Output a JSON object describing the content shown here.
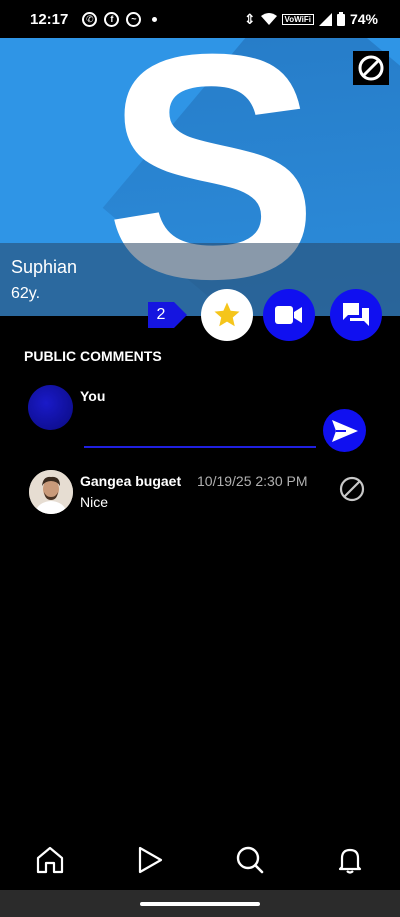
{
  "status_bar": {
    "time": "12:17",
    "app_icons": [
      "whatsapp-icon",
      "facebook-icon",
      "messenger-icon"
    ],
    "network_label": "VoWiFi",
    "battery": "74%"
  },
  "profile": {
    "name": "Suphian",
    "age": "62y.",
    "logo_letter": "S",
    "hero_color": "#2f95e6"
  },
  "actions": {
    "badge_count": "2",
    "accent_color": "#1010f0"
  },
  "comments": {
    "section_title": "PUBLIC COMMENTS",
    "you_label": "You",
    "input_value": "",
    "items": [
      {
        "author": "Gangea bugaet",
        "timestamp": "10/19/25 2:30 PM",
        "text": "Nice"
      }
    ]
  },
  "bottom_nav": {
    "items": [
      "home-icon",
      "play-icon",
      "search-icon",
      "bell-icon"
    ]
  }
}
